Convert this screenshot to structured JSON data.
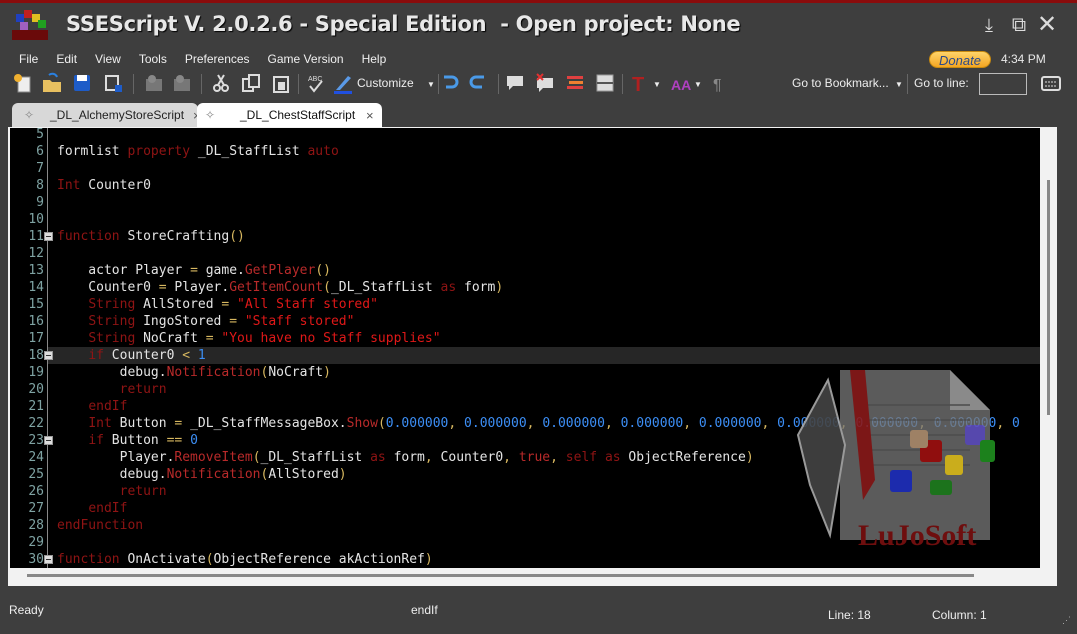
{
  "window": {
    "title": "SSEScript V. 2.0.2.6 - Special Edition  - Open project: None",
    "controls": [
      "minimize",
      "maximize",
      "close"
    ]
  },
  "menu": [
    "File",
    "Edit",
    "View",
    "Tools",
    "Preferences",
    "Game Version",
    "Help"
  ],
  "donate_label": "Donate",
  "clock": "4:34 PM",
  "toolbar": {
    "customize_label": "Customize",
    "bookmark_label": "Go to Bookmark...",
    "goto_line_label": "Go to line:",
    "goto_line_value": ""
  },
  "tabs": [
    {
      "label": "_DL_AlchemyStoreScript",
      "active": false
    },
    {
      "label": "_DL_ChestStaffScript",
      "active": true
    }
  ],
  "tab_close": "×",
  "editor": {
    "current_line": 18,
    "fold_lines": [
      11,
      18,
      23,
      30
    ],
    "lines": [
      {
        "n": "5",
        "tokens": []
      },
      {
        "n": "6",
        "tokens": [
          [
            "formlist ",
            "id"
          ],
          [
            "property",
            "kw"
          ],
          [
            " _DL_StaffList ",
            "id"
          ],
          [
            "auto",
            "kw"
          ]
        ]
      },
      {
        "n": "7",
        "tokens": []
      },
      {
        "n": "8",
        "tokens": [
          [
            "Int",
            "kw"
          ],
          [
            " Counter0",
            "id"
          ]
        ]
      },
      {
        "n": "9",
        "tokens": []
      },
      {
        "n": "10",
        "tokens": []
      },
      {
        "n": "11",
        "tokens": [
          [
            "function",
            "kw"
          ],
          [
            " StoreCrafting",
            "id"
          ],
          [
            "()",
            "op"
          ]
        ]
      },
      {
        "n": "12",
        "tokens": []
      },
      {
        "n": "13",
        "tokens": [
          [
            "    actor Player ",
            "id"
          ],
          [
            "=",
            "op"
          ],
          [
            " game.",
            "id"
          ],
          [
            "GetPlayer",
            "fn"
          ],
          [
            "()",
            "op"
          ]
        ]
      },
      {
        "n": "14",
        "tokens": [
          [
            "    Counter0 ",
            "id"
          ],
          [
            "=",
            "op"
          ],
          [
            " Player.",
            "id"
          ],
          [
            "GetItemCount",
            "fn"
          ],
          [
            "(",
            "op"
          ],
          [
            "_DL_StaffList ",
            "id"
          ],
          [
            "as",
            "kw"
          ],
          [
            " form",
            "id"
          ],
          [
            ")",
            "op"
          ]
        ]
      },
      {
        "n": "15",
        "tokens": [
          [
            "    ",
            "id"
          ],
          [
            "String",
            "kw"
          ],
          [
            " AllStored ",
            "id"
          ],
          [
            "=",
            "op"
          ],
          [
            " ",
            "id"
          ],
          [
            "\"All Staff stored\"",
            "str"
          ]
        ]
      },
      {
        "n": "16",
        "tokens": [
          [
            "    ",
            "id"
          ],
          [
            "String",
            "kw"
          ],
          [
            " IngoStored ",
            "id"
          ],
          [
            "=",
            "op"
          ],
          [
            " ",
            "id"
          ],
          [
            "\"Staff stored\"",
            "str"
          ]
        ]
      },
      {
        "n": "17",
        "tokens": [
          [
            "    ",
            "id"
          ],
          [
            "String",
            "kw"
          ],
          [
            " NoCraft ",
            "id"
          ],
          [
            "=",
            "op"
          ],
          [
            " ",
            "id"
          ],
          [
            "\"You have no Staff supplies\"",
            "str"
          ]
        ]
      },
      {
        "n": "18",
        "tokens": [
          [
            "    ",
            "id"
          ],
          [
            "if",
            "kw"
          ],
          [
            " Counter0 ",
            "id"
          ],
          [
            "<",
            "op"
          ],
          [
            " ",
            "id"
          ],
          [
            "1",
            "num"
          ]
        ]
      },
      {
        "n": "19",
        "tokens": [
          [
            "        debug.",
            "id"
          ],
          [
            "Notification",
            "fn"
          ],
          [
            "(",
            "op"
          ],
          [
            "NoCraft",
            "id"
          ],
          [
            ")",
            "op"
          ]
        ]
      },
      {
        "n": "20",
        "tokens": [
          [
            "        ",
            "id"
          ],
          [
            "return",
            "kw"
          ]
        ]
      },
      {
        "n": "21",
        "tokens": [
          [
            "    ",
            "id"
          ],
          [
            "endIf",
            "kw"
          ]
        ]
      },
      {
        "n": "22",
        "tokens": [
          [
            "    ",
            "id"
          ],
          [
            "Int",
            "kw"
          ],
          [
            " Button ",
            "id"
          ],
          [
            "=",
            "op"
          ],
          [
            " _DL_StaffMessageBox.",
            "id"
          ],
          [
            "Show",
            "fn"
          ],
          [
            "(",
            "op"
          ],
          [
            "0.000000",
            "num"
          ],
          [
            ", ",
            "op"
          ],
          [
            "0.000000",
            "num"
          ],
          [
            ", ",
            "op"
          ],
          [
            "0.000000",
            "num"
          ],
          [
            ", ",
            "op"
          ],
          [
            "0.000000",
            "num"
          ],
          [
            ", ",
            "op"
          ],
          [
            "0.000000",
            "num"
          ],
          [
            ", ",
            "op"
          ],
          [
            "0.000000",
            "num"
          ],
          [
            ", ",
            "op"
          ],
          [
            "0.000000",
            "num"
          ],
          [
            ", ",
            "op"
          ],
          [
            "0.000000",
            "num"
          ],
          [
            ", ",
            "op"
          ],
          [
            "0",
            "num"
          ]
        ]
      },
      {
        "n": "23",
        "tokens": [
          [
            "    ",
            "id"
          ],
          [
            "if",
            "kw"
          ],
          [
            " Button ",
            "id"
          ],
          [
            "==",
            "op"
          ],
          [
            " ",
            "id"
          ],
          [
            "0",
            "num"
          ]
        ]
      },
      {
        "n": "24",
        "tokens": [
          [
            "        Player.",
            "id"
          ],
          [
            "RemoveItem",
            "fn"
          ],
          [
            "(",
            "op"
          ],
          [
            "_DL_StaffList ",
            "id"
          ],
          [
            "as",
            "kw"
          ],
          [
            " form",
            "id"
          ],
          [
            ", ",
            "op"
          ],
          [
            "Counter0",
            "id"
          ],
          [
            ", ",
            "op"
          ],
          [
            "true",
            "fn"
          ],
          [
            ", ",
            "op"
          ],
          [
            "self",
            "kw"
          ],
          [
            " ",
            "id"
          ],
          [
            "as",
            "kw"
          ],
          [
            " ObjectReference",
            "id"
          ],
          [
            ")",
            "op"
          ]
        ]
      },
      {
        "n": "25",
        "tokens": [
          [
            "        debug.",
            "id"
          ],
          [
            "Notification",
            "fn"
          ],
          [
            "(",
            "op"
          ],
          [
            "AllStored",
            "id"
          ],
          [
            ")",
            "op"
          ]
        ]
      },
      {
        "n": "26",
        "tokens": [
          [
            "        ",
            "id"
          ],
          [
            "return",
            "kw"
          ]
        ]
      },
      {
        "n": "27",
        "tokens": [
          [
            "    ",
            "id"
          ],
          [
            "endIf",
            "kw"
          ]
        ]
      },
      {
        "n": "28",
        "tokens": [
          [
            "endFunction",
            "kw"
          ]
        ]
      },
      {
        "n": "29",
        "tokens": []
      },
      {
        "n": "30",
        "tokens": [
          [
            "function",
            "kw"
          ],
          [
            " OnActivate",
            "id"
          ],
          [
            "(",
            "op"
          ],
          [
            "ObjectReference akActionRef",
            "id"
          ],
          [
            ")",
            "op"
          ]
        ]
      }
    ]
  },
  "watermark": "LuJoSoft",
  "status": {
    "state": "Ready",
    "keyword": "endIf",
    "line": "Line: 18",
    "column": "Column: 1"
  },
  "colors": {
    "keyword": "#8f1414",
    "function": "#b82a2a",
    "string": "#e01818",
    "number": "#3c8ef5",
    "operator": "#d8b860",
    "accent": "#8a0c0c"
  }
}
